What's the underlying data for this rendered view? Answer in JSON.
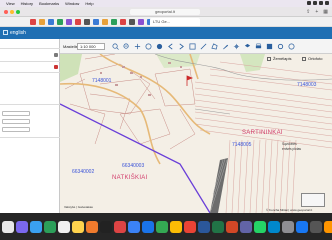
{
  "menubar": {
    "items": [
      "View",
      "History",
      "Bookmarks",
      "Window",
      "Help"
    ]
  },
  "browser": {
    "address": "geoportal.lt",
    "tab_label": "LTU Ge..."
  },
  "app": {
    "header_label": "english"
  },
  "toolbar": {
    "scale_label": "Mastelis:",
    "scale_value": "1:10 000"
  },
  "map": {
    "parcel_labels": [
      "7148001",
      "7148003",
      "66340003",
      "66340002",
      "7148005"
    ],
    "place_labels": [
      "SARTININKAI",
      "NATKIŠKIAI"
    ],
    "legend": {
      "layers_label": "Žemėlapis",
      "ortho_label": "Ortofoto",
      "note_line1": "Sąvokėlės",
      "note_line2": "erdvės plotas"
    },
    "scale_text": "Valstybė | Gatvėtakas",
    "copyright": "© Koncha Mišiai | www.geoportal.lt"
  },
  "colors": {
    "header_blue": "#1f6fb3",
    "boundary_purple": "#6a3fd8",
    "parcel_blue": "#3a53d8",
    "place_red": "#d23c6b",
    "road": "#e6b978"
  }
}
